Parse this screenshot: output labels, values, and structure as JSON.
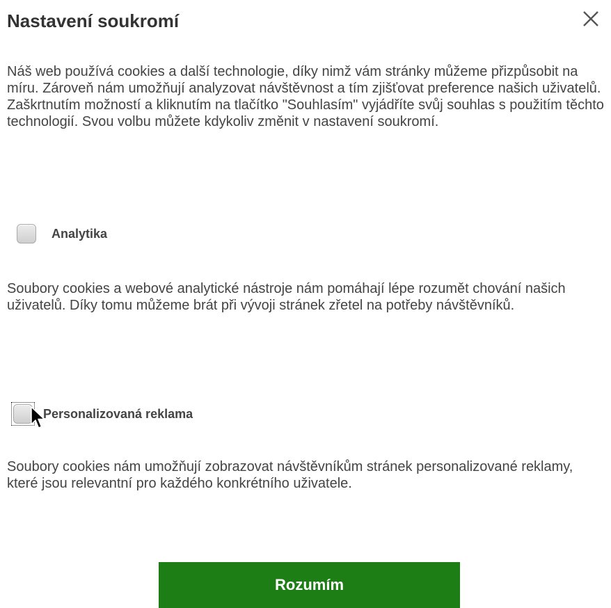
{
  "dialog": {
    "title": "Nastavení soukromí",
    "close_icon": "close-icon",
    "intro_text": "Náš web používá cookies a další technologie, díky nimž vám stránky můžeme přizpůsobit na míru. Zároveň nám umožňují analyzovat návštěvnost a tím zjišťovat preference našich uživatelů. Zaškrtnutím možností a kliknutím na tlačítko \"Souhlasím\" vyjádříte svůj souhlas s použitím těchto technologií. Svou volbu můžete kdykoliv změnit v nastavení soukromí."
  },
  "options": [
    {
      "label": "Analytika",
      "checked": false,
      "description": "Soubory cookies a webové analytické nástroje nám pomáhají lépe rozumět chování našich uživatelů. Díky tomu můžeme brát při vývoji stránek zřetel na potřeby návštěvníků."
    },
    {
      "label": "Personalizovaná reklama",
      "checked": false,
      "focused": true,
      "description": "Soubory cookies nám umožňují zobrazovat návštěvníkům stránek personalizované reklamy, které jsou relevantní pro každého konkrétního uživatele."
    }
  ],
  "accept_button": {
    "label": "Rozumím"
  },
  "colors": {
    "accent": "#1e7e16",
    "text": "#444444",
    "title": "#333333"
  }
}
